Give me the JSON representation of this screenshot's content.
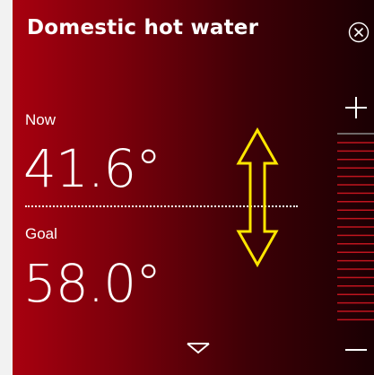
{
  "header": {
    "title": "Domestic hot water",
    "close_icon": "close-circle-icon"
  },
  "now": {
    "label": "Now",
    "value": "41.6°"
  },
  "goal": {
    "label": "Goal",
    "value": "58.0°"
  },
  "controls": {
    "increase_icon": "plus-icon",
    "decrease_icon": "minus-icon",
    "expand_icon": "chevron-down-icon",
    "drag_icon": "double-arrow-vertical-icon"
  },
  "colors": {
    "gradient_start": "#a8000f",
    "gradient_end": "#1a0003",
    "scale_tick": "#c0141e",
    "overlay_arrow": "#ffe600",
    "text": "#ffffff"
  }
}
